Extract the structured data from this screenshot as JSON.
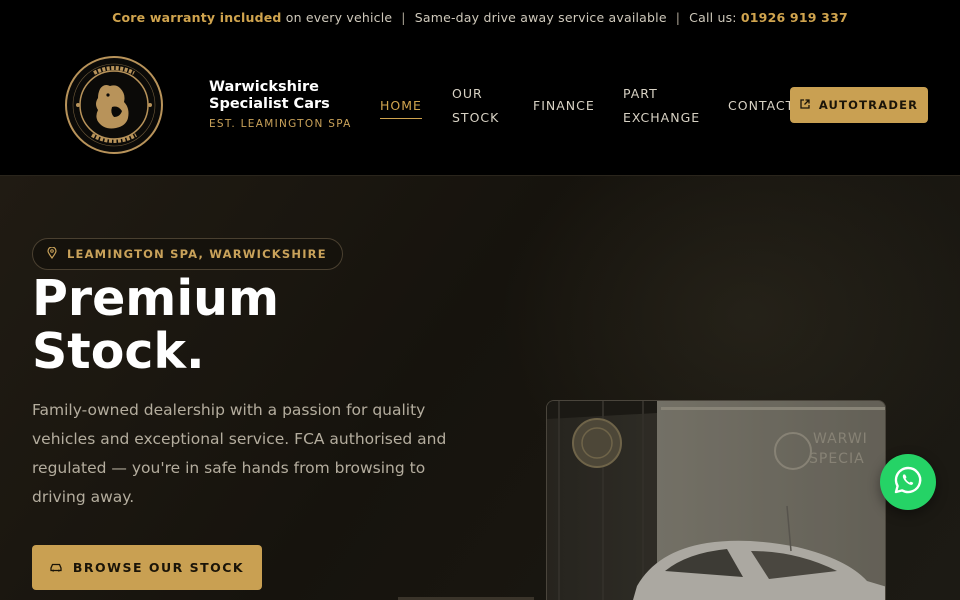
{
  "topbar": {
    "warranty_bold": "Core warranty included",
    "warranty_rest": " on every vehicle",
    "separator": "|",
    "sameday": "Same-day drive away service available",
    "call_label": "Call us: ",
    "phone": "01926 919 337"
  },
  "brand": {
    "name": "Warwickshire Specialist Cars",
    "tagline": "EST. LEAMINGTON SPA",
    "logo_icon": "bear-seal-logo"
  },
  "nav": {
    "items": [
      {
        "label": "HOME",
        "active": true
      },
      {
        "label": "OUR STOCK",
        "active": false
      },
      {
        "label": "FINANCE",
        "active": false
      },
      {
        "label": "PART EXCHANGE",
        "active": false
      },
      {
        "label": "CONTACT",
        "active": false
      }
    ],
    "autotrader_label": "AUTOTRADER",
    "autotrader_icon": "external-link-icon"
  },
  "hero": {
    "location": "LEAMINGTON SPA, WARWICKSHIRE",
    "location_icon": "map-pin-icon",
    "title_line1": "Premium",
    "title_line2": "Stock.",
    "description": "Family-owned dealership with a passion for quality vehicles and exceptional service. FCA authorised and regulated — you're in safe hands from browsing to driving away.",
    "cta_label": "BROWSE OUR STOCK",
    "cta_icon": "car-icon",
    "photo_icon": "showroom-car-photo"
  },
  "floating": {
    "whatsapp_icon": "whatsapp-icon"
  },
  "colors": {
    "gold": "#c9a052",
    "black": "#000000",
    "whatsapp": "#25d366"
  }
}
